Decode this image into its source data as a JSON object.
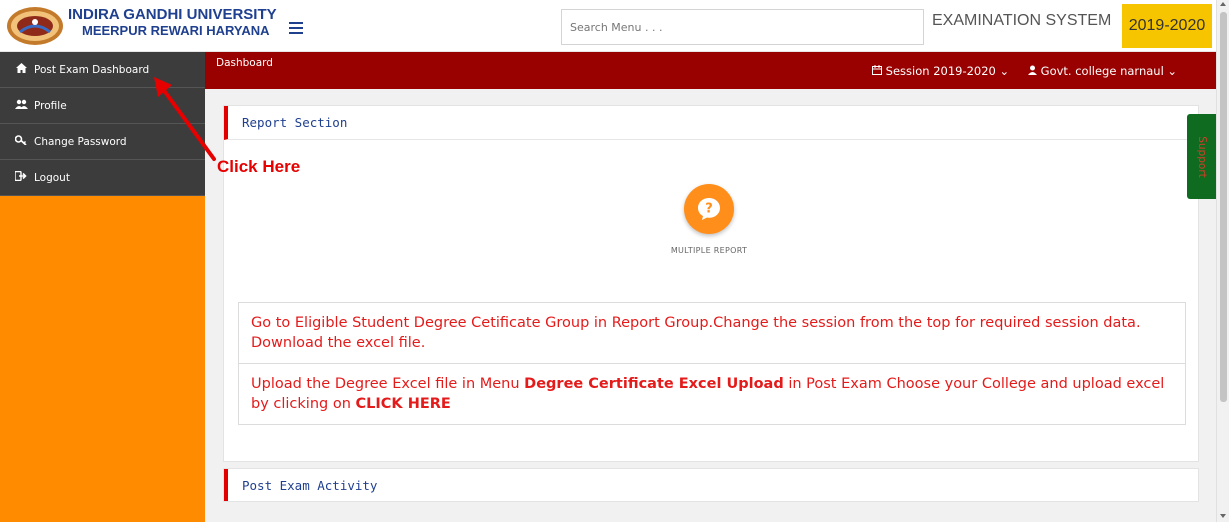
{
  "header": {
    "university_line1": "INDIRA GANDHI UNIVERSITY",
    "university_line2": "MEERPUR REWARI HARYANA",
    "search_placeholder": "Search Menu . . .",
    "system_title": "EXAMINATION SYSTEM",
    "year": "2019-2020",
    "year_color": "#f6c500"
  },
  "sidebar": {
    "items": [
      {
        "label": "Post Exam Dashboard",
        "icon": "home-icon"
      },
      {
        "label": "Profile",
        "icon": "users-icon"
      },
      {
        "label": "Change Password",
        "icon": "key-icon"
      },
      {
        "label": "Logout",
        "icon": "sign-out-icon"
      }
    ],
    "bg_color": "#ff8c00"
  },
  "topbar": {
    "breadcrumb": "Dashboard",
    "session_label": "Session 2019-2020",
    "user_label": "Govt. college narnaul",
    "bg_color": "#990000"
  },
  "report_section": {
    "title": "Report Section",
    "button_label": "MULTIPLE REPORT",
    "note1": "Go to Eligible Student Degree Cetificate Group in Report Group.Change the session from the top for required session data. Download the excel file.",
    "note2_pre": "Upload the Degree Excel file in Menu ",
    "note2_bold1": "Degree Certificate Excel Upload",
    "note2_mid": " in Post Exam Choose your College and upload excel by clicking on ",
    "note2_bold2": "CLICK HERE"
  },
  "post_exam_activity": {
    "title": "Post Exam Activity"
  },
  "support_tab": {
    "label": "Support"
  },
  "annotation": {
    "text": "Click Here",
    "color": "#e60000"
  }
}
